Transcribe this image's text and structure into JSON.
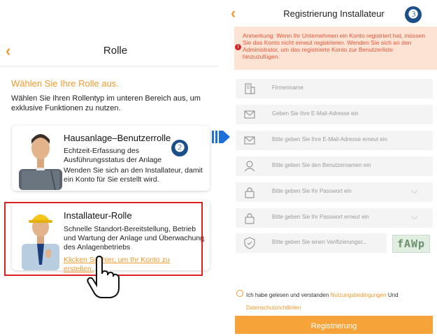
{
  "left_screen": {
    "title": "Rolle",
    "heading": "Wählen Sie Ihre Rolle aus.",
    "description": "Wählen Sie Ihren Rollentyp im unteren Bereich aus, um exklusive Funktionen zu nutzen.",
    "roles": [
      {
        "title": "Hausanlage–Benutzerrolle",
        "text1": "Echtzeit-Erfassung des Ausführungsstatus der Anlage",
        "text2": "Wenden Sie sich an den Installateur, damit ein Konto für Sie erstellt wird."
      },
      {
        "title": "Installateur-Rolle",
        "text1": "Schnelle Standort-Bereitstellung, Betrieb und Wartung der Anlage und Überwachung des Anlagenbetriebs",
        "link": "Klicken Sie hier, um Ihr Konto zu erstellen."
      }
    ],
    "badge": "❷"
  },
  "right_screen": {
    "title": "Registrierung Installateur",
    "badge": "❸",
    "notice": "Anmerkung: Wenn Ihr Unternehmen ein Konto registriert hat, müssen Sie das Konto nicht erneut registrieren. Wenden Sie sich an den Administrator, um das registrierte Konto zur Benutzerliste hinzuzufügen.",
    "fields": [
      {
        "placeholder": "Firmenname",
        "icon": "building-icon"
      },
      {
        "placeholder": "Geben Sie Ihre E-Mail-Adresse ein",
        "icon": "mail-icon"
      },
      {
        "placeholder": "Bitte geben Sie Ihre E-Mail-Adresse erneut ein",
        "icon": "mail-icon"
      },
      {
        "placeholder": "Bitte geben Sie den Benutzernamen ein",
        "icon": "user-icon"
      },
      {
        "placeholder": "Bitte geben Sie Ihr Passwort ein",
        "icon": "lock-icon"
      },
      {
        "placeholder": "Bitte geben Sie Ihr Passwort erneut ein",
        "icon": "lock-icon"
      },
      {
        "placeholder": "Bitte geben Sie einen Verifizierungsc..",
        "icon": "shield-icon"
      }
    ],
    "captcha": "fAWp",
    "agree_prefix": "Ich habe gelesen und verstanden",
    "terms_link": "Nutzungsbedingungen",
    "agree_and": "Und",
    "privacy_link": "Datenschutzrichtlinien",
    "register_button": "Registrierung"
  },
  "colors": {
    "accent": "#f29a2e",
    "highlight": "#e02020",
    "badge": "#1a4f8a",
    "notice_bg": "#fde3d3"
  }
}
